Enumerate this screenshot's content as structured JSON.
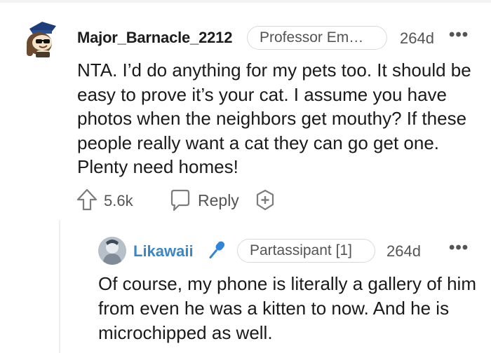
{
  "comment": {
    "username": "Major_Barnacle_2212",
    "flair": "Professor Em…",
    "age": "264d",
    "more": "•••",
    "body": "NTA. I’d do anything for my pets too. It should be easy to prove it’s your cat. I assume you have photos when the neighbors get mouthy? If these people really want a cat they can go get one. Plenty need homes!",
    "score": "5.6k",
    "reply_label": "Reply",
    "icons": [
      "avatar",
      "upvote-icon",
      "reply-icon",
      "award-icon",
      "more-icon"
    ]
  },
  "reply": {
    "username": "Likawaii",
    "flair": "Partassipant [1]",
    "age": "264d",
    "more": "•••",
    "body": "Of course, my phone is literally a gallery of him from even he was a kitten to now. And he is microchipped as well.",
    "icons": [
      "avatar",
      "microphone-icon",
      "more-icon"
    ]
  },
  "colors": {
    "username_main": "#1c1c1c",
    "username_reply": "#3a87c8",
    "meta_text": "#545454",
    "border": "#d7dadc"
  }
}
